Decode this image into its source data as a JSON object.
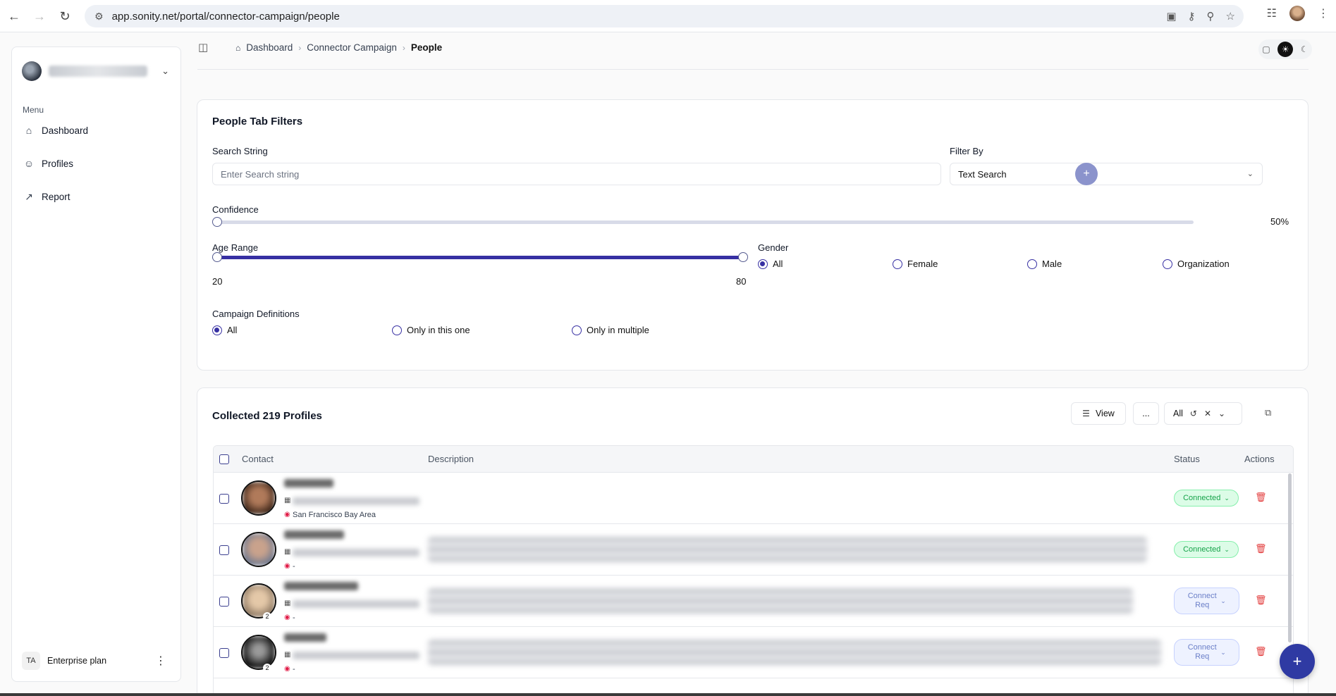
{
  "browser": {
    "url": "app.sonity.net/portal/connector-campaign/people"
  },
  "sidebar": {
    "menu_title": "Menu",
    "items": [
      {
        "label": "Dashboard",
        "icon": "home-icon"
      },
      {
        "label": "Profiles",
        "icon": "users-icon"
      },
      {
        "label": "Report",
        "icon": "chart-icon"
      }
    ],
    "footer": {
      "initials": "TA",
      "plan": "Enterprise plan"
    }
  },
  "breadcrumb": {
    "items": [
      "Dashboard",
      "Connector Campaign"
    ],
    "current": "People"
  },
  "filters": {
    "title": "People Tab Filters",
    "search_label": "Search String",
    "search_placeholder": "Enter Search string",
    "filter_by_label": "Filter By",
    "filter_by_value": "Text Search",
    "confidence_label": "Confidence",
    "confidence_value": "50%",
    "confidence_fraction": 0.0,
    "age_label": "Age Range",
    "age_min": "20",
    "age_max": "80",
    "gender_label": "Gender",
    "gender_options": [
      "All",
      "Female",
      "Male",
      "Organization"
    ],
    "gender_selected": "All",
    "campaign_label": "Campaign Definitions",
    "campaign_options": [
      "All",
      "Only in this one",
      "Only in multiple"
    ],
    "campaign_selected": "All"
  },
  "profiles": {
    "title": "Collected 219 Profiles",
    "view_label": "View",
    "more_label": "...",
    "all_filter": "All",
    "columns": {
      "contact": "Contact",
      "description": "Description",
      "status": "Status",
      "actions": "Actions"
    },
    "rows": [
      {
        "location": "San Francisco Bay Area",
        "status": "Connected",
        "status_type": "connected"
      },
      {
        "location": "-",
        "status": "Connected",
        "status_type": "connected"
      },
      {
        "location": "-",
        "status": "Connect Req",
        "status_type": "req",
        "badge": "2"
      },
      {
        "location": "-",
        "status": "Connect Req",
        "status_type": "req",
        "badge": "2"
      }
    ]
  },
  "colors": {
    "accent": "#3730a3",
    "connected_bg": "#dcfce7",
    "connected_text": "#16a34a",
    "req_bg": "#eef2ff",
    "danger": "#e23b3b"
  }
}
